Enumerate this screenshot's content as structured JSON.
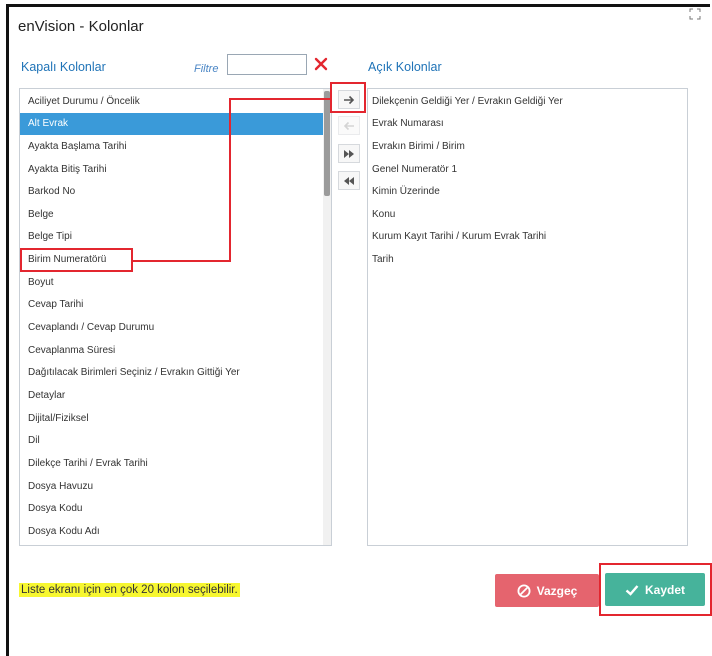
{
  "dialog": {
    "title": "enVision - Kolonlar"
  },
  "closed_columns": {
    "label": "Kapalı Kolonlar",
    "filter_label": "Filtre",
    "filter_value": "",
    "items": [
      "Aciliyet Durumu / Öncelik",
      "Alt Evrak",
      "Ayakta Başlama Tarihi",
      "Ayakta Bitiş Tarihi",
      "Barkod No",
      "Belge",
      "Belge Tipi",
      "Birim Numeratörü",
      "Boyut",
      "Cevap Tarihi",
      "Cevaplandı / Cevap Durumu",
      "Cevaplanma Süresi",
      "Dağıtılacak Birimleri Seçiniz / Evrakın Gittiği Yer",
      "Detaylar",
      "Dijital/Fiziksel",
      "Dil",
      "Dilekçe Tarihi / Evrak Tarihi",
      "Dosya Havuzu",
      "Dosya Kodu",
      "Dosya Kodu Adı"
    ],
    "selected_index": 1
  },
  "open_columns": {
    "label": "Açık Kolonlar",
    "items": [
      "Dilekçenin Geldiği Yer / Evrakın Geldiği Yer",
      "Evrak Numarası",
      "Evrakın Birimi / Birim",
      "Genel Numeratör 1",
      "Kimin Üzerinde",
      "Konu",
      "Kurum Kayıt Tarihi / Kurum Evrak Tarihi",
      "Tarih"
    ]
  },
  "footer": {
    "info": "Liste ekranı için en çok 20 kolon seçilebilir.",
    "cancel_label": "Vazgeç",
    "save_label": "Kaydet"
  },
  "colors": {
    "accent_blue": "#3a9ad9",
    "cancel_red": "#e5646e",
    "save_green": "#46b39b",
    "highlight_red": "#e3262f",
    "info_yellow": "#f7f730"
  }
}
